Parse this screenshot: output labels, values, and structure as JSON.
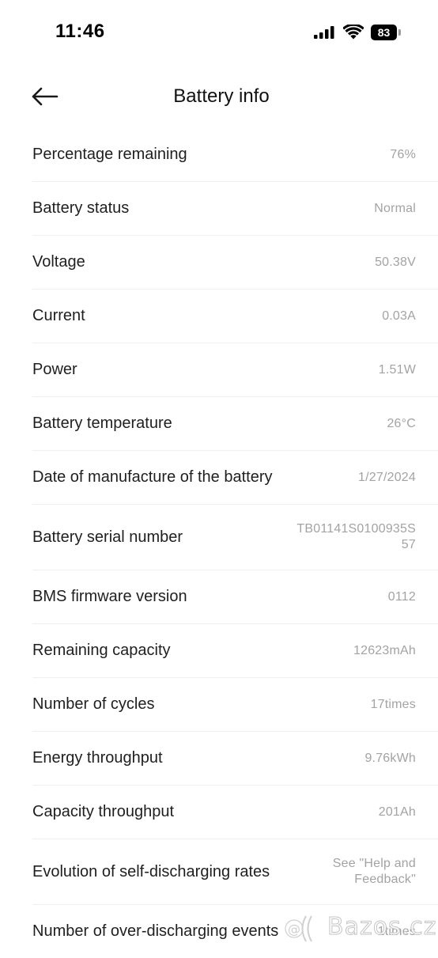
{
  "status_bar": {
    "time": "11:46",
    "battery_level": "83",
    "icons": [
      "cellular-signal-icon",
      "wifi-icon",
      "battery-icon"
    ]
  },
  "header": {
    "title": "Battery info",
    "back_icon": "back-arrow-icon"
  },
  "rows": [
    {
      "label": "Percentage remaining",
      "value": "76%"
    },
    {
      "label": "Battery status",
      "value": "Normal"
    },
    {
      "label": "Voltage",
      "value": "50.38V"
    },
    {
      "label": "Current",
      "value": "0.03A"
    },
    {
      "label": "Power",
      "value": "1.51W"
    },
    {
      "label": "Battery temperature",
      "value": "26°C"
    },
    {
      "label": "Date of manufacture of the battery",
      "value": "1/27/2024"
    },
    {
      "label": "Battery serial number",
      "value": "TB01141S0100935S57"
    },
    {
      "label": "BMS firmware version",
      "value": "0112"
    },
    {
      "label": "Remaining capacity",
      "value": "12623mAh"
    },
    {
      "label": "Number of cycles",
      "value": "17times"
    },
    {
      "label": "Energy throughput",
      "value": "9.76kWh"
    },
    {
      "label": "Capacity throughput",
      "value": "201Ah"
    },
    {
      "label": "Evolution of self-discharging rates",
      "value": "See \"Help and Feedback\""
    },
    {
      "label": "Number of over-discharging events",
      "value": "1times"
    }
  ],
  "watermark": {
    "text": "Bazos.cz"
  }
}
